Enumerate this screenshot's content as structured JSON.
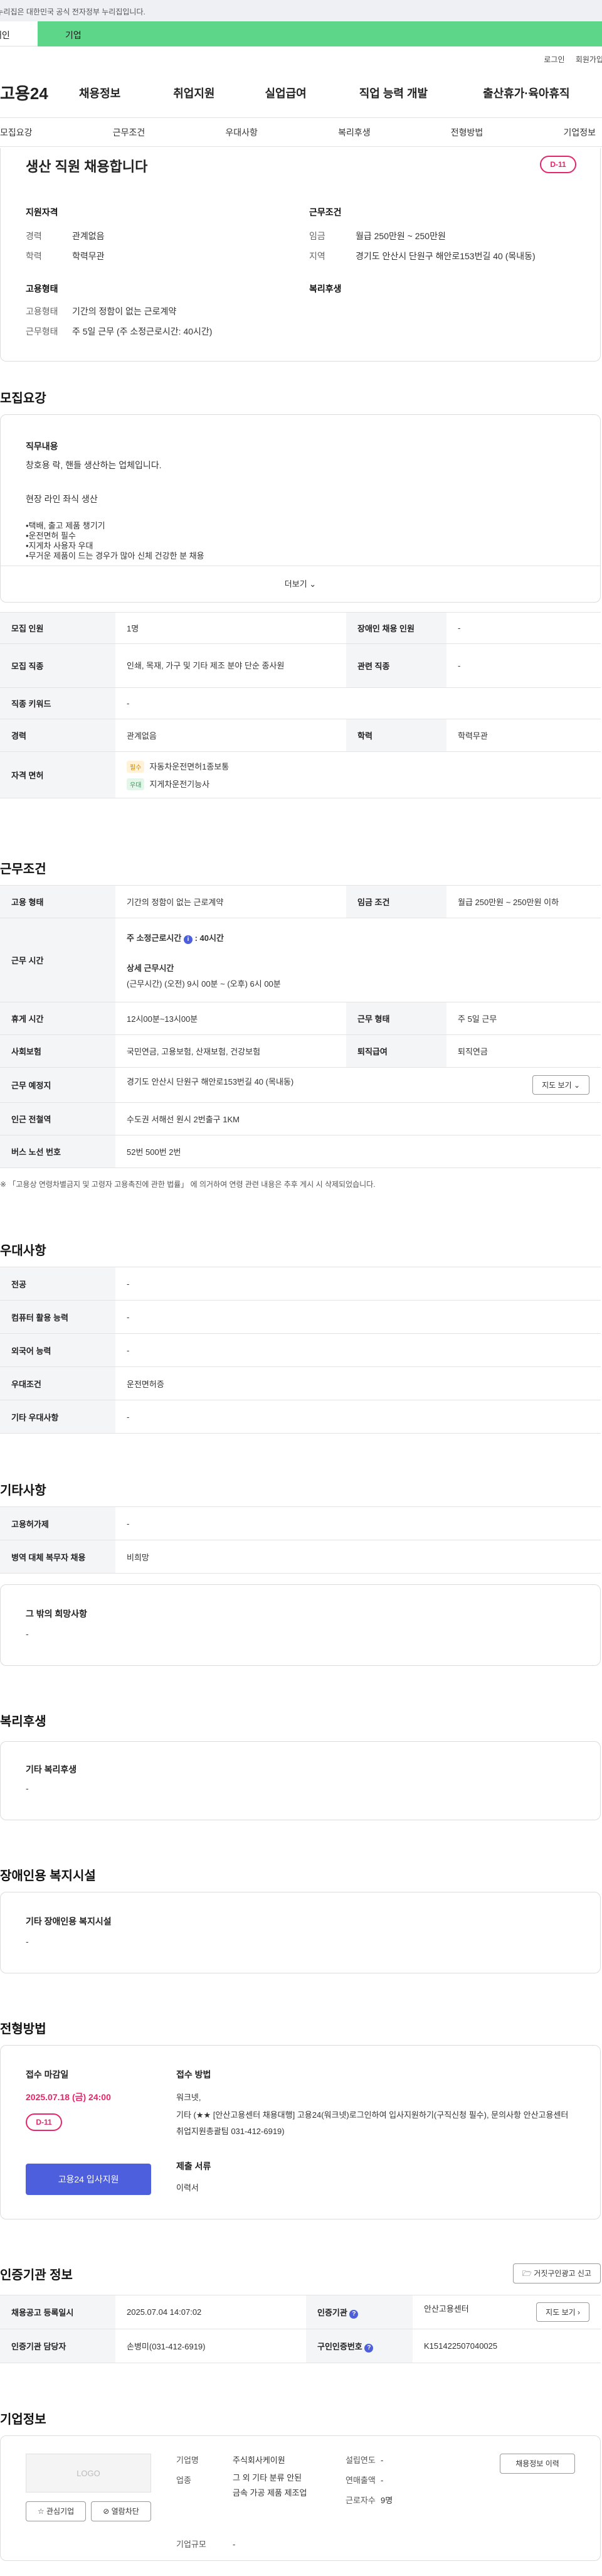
{
  "gov_banner": "이 누리집은 대한민국 공식 전자정부 누리집입니다.",
  "tabs": {
    "personal": "개인",
    "corp": "기업"
  },
  "util": {
    "login": "로그인",
    "join": "회원가입"
  },
  "brand": "고용24",
  "gnb": [
    "채용정보",
    "취업지원",
    "실업급여",
    "직업 능력 개발",
    "출산휴가·육아휴직"
  ],
  "anchor_nav": [
    "모집요강",
    "근무조건",
    "우대사항",
    "복리후생",
    "전형방법",
    "기업정보"
  ],
  "summary": {
    "title": "생산 직원 채용합니다",
    "dday": "D-11",
    "qual_title": "지원자격",
    "qual": [
      {
        "k": "경력",
        "v": "관계없음"
      },
      {
        "k": "학력",
        "v": "학력무관"
      }
    ],
    "work_title": "근무조건",
    "work": [
      {
        "k": "임금",
        "v": "월급 250만원 ~ 250만원"
      },
      {
        "k": "지역",
        "v": "경기도 안산시 단원구 해안로153번길 40 (목내동)"
      }
    ],
    "emp_title": "고용형태",
    "emp": [
      {
        "k": "고용형태",
        "v": "기간의 정함이 없는 근로계약"
      },
      {
        "k": "근무형태",
        "v": "주 5일 근무 (주 소정근로시간: 40시간)"
      }
    ],
    "welfare_title": "복리후생"
  },
  "recruit": {
    "title": "모집요강",
    "desc_label": "직무내용",
    "desc_lines": [
      "창호용 락, 핸들 생산하는 업체입니다.",
      "",
      "현장 라인 좌식 생산",
      "",
      "•택배, 출고 제품 챙기기",
      "•운전면허 필수",
      "•지게차 사용자 우대",
      "•무거운 제품이 드는 경우가 많아  신체 건강한 분 채용"
    ],
    "more": "더보기",
    "headcount_k": "모집 인원",
    "headcount_v": "1명",
    "disabled_k": "장애인 채용 인원",
    "disabled_v": "-",
    "job_k": "모집 직종",
    "job_v": "인쇄, 목재, 가구 및 기타 제조 분야 단순 종사원",
    "rel_job_k": "관련 직종",
    "rel_job_v": "-",
    "keyword_k": "직종 키워드",
    "keyword_v": "-",
    "career_k": "경력",
    "career_v": "관계없음",
    "edu_k": "학력",
    "edu_v": "학력무관",
    "license_k": "자격 면허",
    "licenses": [
      {
        "tag": "필수",
        "name": "자동차운전면허1종보통"
      },
      {
        "tag": "우대",
        "name": "지게차운전기능사"
      }
    ]
  },
  "conditions": {
    "title": "근무조건",
    "emp_k": "고용 형태",
    "emp_v": "기간의 정함이 없는 근로계약",
    "wage_k": "임금 조건",
    "wage_v": "월급 250만원 ~ 250만원 이하",
    "hours_k": "근무 시간",
    "hours_week_label": "주 소정근로시간",
    "hours_week": "40시간",
    "hours_detail_label": "상세 근무시간",
    "hours_detail": "(근무시간) (오전) 9시 00분 ~ (오후) 6시 00분",
    "break_k": "휴게 시간",
    "break_v": "12시00분~13시00분",
    "type_k": "근무 형태",
    "type_v": "주 5일 근무",
    "insurance_k": "사회보험",
    "insurance_v": "국민연금, 고용보험, 산재보험, 건강보험",
    "severance_k": "퇴직급여",
    "severance_v": "퇴직연금",
    "place_k": "근무 예정지",
    "place_v": "경기도 안산시 단원구 해안로153번길 40 (목내동)",
    "map_btn": "지도 보기",
    "subway_k": "인근 전철역",
    "subway_v": "수도권 서해선 원시 2번출구 1KM",
    "bus_k": "버스 노선 번호",
    "bus_v": "52번 500번 2번"
  },
  "note": "※ 「고용상 연령차별금지 및 고령자 고용촉진에 관한 법률」 에 의거하여 연령 관련 내용은 추후 게시 시 삭제되었습니다.",
  "prefer": {
    "title": "우대사항",
    "rows": [
      {
        "k": "전공",
        "v": "-"
      },
      {
        "k": "컴퓨터 활용 능력",
        "v": "-"
      },
      {
        "k": "외국어 능력",
        "v": "-"
      },
      {
        "k": "우대조건",
        "v": "운전면허증"
      },
      {
        "k": "기타 우대사항",
        "v": "-"
      }
    ]
  },
  "etc": {
    "title": "기타사항",
    "rows": [
      {
        "k": "고용허가제",
        "v": "-"
      },
      {
        "k": "병역 대체 복무자 채용",
        "v": "비희망"
      }
    ],
    "other_title": "그 밖의 희망사항",
    "other_v": "-"
  },
  "welfare": {
    "title": "복리후생",
    "box_title": "기타 복리후생",
    "box_v": "-"
  },
  "disabled_fac": {
    "title": "장애인용 복지시설",
    "box_title": "기타 장애인용 복지시설",
    "box_v": "-"
  },
  "screening": {
    "title": "전형방법",
    "deadline_label": "접수 마감일",
    "deadline": "2025.07.18 (금) 24:00",
    "dday": "D-11",
    "method_label": "접수 방법",
    "method_v1": "워크넷,",
    "method_v2": "기타 (★★ [안산고용센터 채용대행] 고용24(워크넷)로그인하여 입사지원하기(구직신청 필수), 문의사항 안산고용센터 취업지원총괄팀 031-412-6919)",
    "docs_label": "제출 서류",
    "docs_v": "이력서",
    "apply_btn": "고용24 입사지원"
  },
  "cert": {
    "title": "인증기관 정보",
    "report_btn": "거짓구인광고 신고",
    "reg_k": "채용공고 등록일시",
    "reg_v": "2025.07.04 14:07:02",
    "org_k": "인증기관",
    "org_v": "안산고용센터",
    "manager_k": "인증기관 담당자",
    "manager_v": "손병미(031-412-6919)",
    "auth_k": "구인인증번호",
    "auth_v": "K151422507040025",
    "map_btn": "지도 보기"
  },
  "company": {
    "title": "기업정보",
    "logo": "LOGO",
    "fav_btn": "관심기업",
    "block_btn": "열람차단",
    "rows_left": [
      {
        "k": "기업명",
        "v": "주식회사케이원"
      },
      {
        "k": "업종",
        "v": "그 외 기타 분류 안된 금속 가공 제품 제조업"
      },
      {
        "k": "기업규모",
        "v": "-"
      }
    ],
    "rows_right": [
      {
        "k": "설립연도",
        "v": "-"
      },
      {
        "k": "연매출액",
        "v": "-"
      },
      {
        "k": "근로자수",
        "v": "9명"
      }
    ],
    "history_btn": "채용정보 이력"
  }
}
